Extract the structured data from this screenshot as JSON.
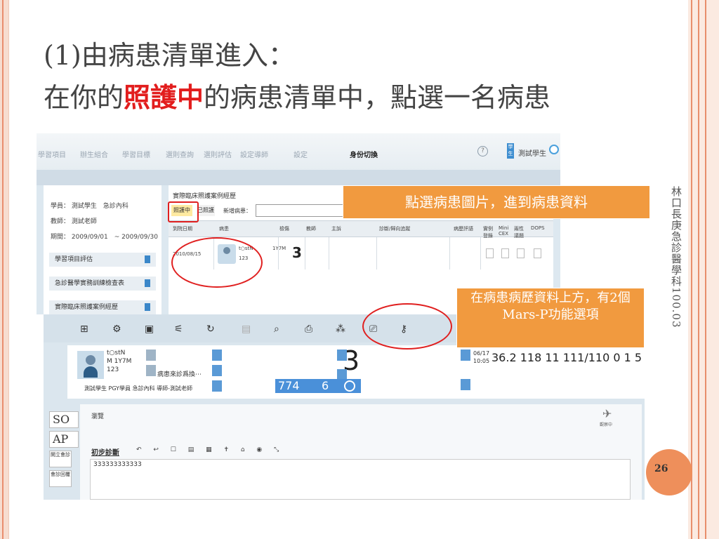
{
  "slide": {
    "title_line1": "(1)由病患清單進入：",
    "title_line2_pre": "在你的",
    "title_line2_highlight": "照護中",
    "title_line2_post": "的病患清單中，點選一名病患",
    "side_label": "林口長庚急診醫學科100.03",
    "page_number": "26",
    "accent_color": "#ee8f5b",
    "highlight_color": "#e21d1d"
  },
  "callouts": {
    "patient_picture": "點選病患圖片，進到病患資料",
    "mars_p": "在病患病歷資料上方，有2個Mars-P功能選項"
  },
  "upper_screen": {
    "nav": [
      "學習項目",
      "辦生組合",
      "學習目標",
      "選則查詢",
      "選則評估",
      "設定導師",
      "設定"
    ],
    "nav_active": "身份切換",
    "user_badge": "學生",
    "user_name": "測試學生",
    "learner_info": {
      "learner": "學員： 測試學生　急診內科",
      "teacher": "教師： 測試老師",
      "period": "期間： 2009/09/01　~ 2009/09/30"
    },
    "left_buttons": [
      "學習項目評估",
      "急診醫學實務訓練檢查表",
      "實際臨床照護案例經歷"
    ],
    "panel_title": "實際臨床照護案例經歷",
    "tab_active": "照護中",
    "tab_other": "已照護",
    "new_patient_label": "新增病患：",
    "columns": [
      "到院日期",
      "病患",
      "檢傷",
      "教師",
      "主訴",
      "診斷/歸向追蹤",
      "病歷評語",
      "實例登錄",
      "Mini CEX",
      "兩性議題",
      "DOPS"
    ],
    "row": {
      "date": "2010/08/15",
      "name": "t○stN",
      "age": "1Y7M",
      "id": "123",
      "triage": "3"
    }
  },
  "lower_screen": {
    "toolbar_icons": [
      "flowchart-icon",
      "gear-icon",
      "search-doc-icon",
      "chart-icon",
      "refresh-icon",
      "save-icon",
      "magnify-icon",
      "print-icon",
      "network-icon",
      "computer-icon",
      "key-icon"
    ],
    "patient": {
      "name": "t○stN",
      "sex_age": "M 1Y7M",
      "id": "123",
      "note": "病患來診爲換⋯",
      "staff": "測試學生 PGY學員 急診內科 導師-測試老師"
    },
    "triage": "3",
    "vitals_numbers": [
      "774",
      "6"
    ],
    "vital_time": "06/17\n10:05",
    "vital_values": "36.2 118 11 111/110  0  1 5 6",
    "soap_tabs": [
      "SO",
      "AP"
    ],
    "small_tabs": [
      "開立會診",
      "會診回覆"
    ],
    "overview_label": "瀏覽",
    "diagnosis_label": "初步診斷",
    "diagnosis_tools": "↶ ↩ ☐ ▤ ▦ ✝ ⌂ ◉ ⤡",
    "diagnosis_text": "333333333333",
    "side_flag_label": "觀察中"
  }
}
